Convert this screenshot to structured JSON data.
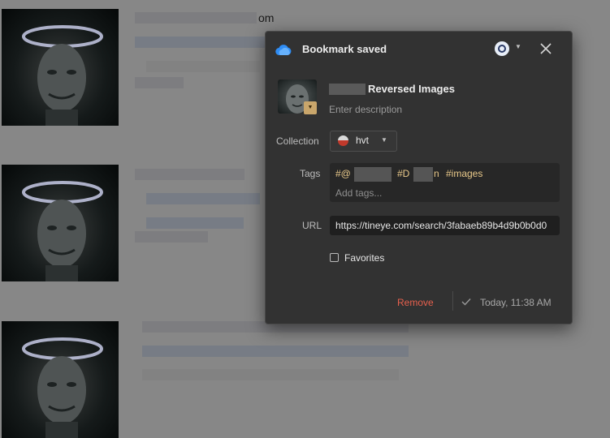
{
  "background": {
    "results": [
      {
        "title_suffix": "om"
      },
      {
        "title_suffix": ""
      },
      {
        "title_suffix": ""
      }
    ]
  },
  "popup": {
    "header": {
      "title": "Bookmark saved",
      "logo_icon": "cloud-logo-icon",
      "account_icon": "account-avatar-icon",
      "close_icon": "close-icon"
    },
    "bookmark": {
      "title": "Reversed Images",
      "description_placeholder": "Enter description"
    },
    "collection": {
      "label": "Collection",
      "value": "hvt"
    },
    "tags": {
      "label": "Tags",
      "items": [
        "#@",
        "#D",
        "n",
        "#images"
      ],
      "placeholder": "Add tags..."
    },
    "url": {
      "label": "URL",
      "value": "https://tineye.com/search/3fabaeb89b4d9b0b0d0"
    },
    "favorites": {
      "label": "Favorites",
      "checked": false
    },
    "footer": {
      "remove_label": "Remove",
      "saved_time": "Today, 11:38 AM"
    },
    "colors": {
      "accent_remove": "#e6604d",
      "tag_color": "#e9c98a",
      "logo_blue": "#2f8df5"
    }
  }
}
